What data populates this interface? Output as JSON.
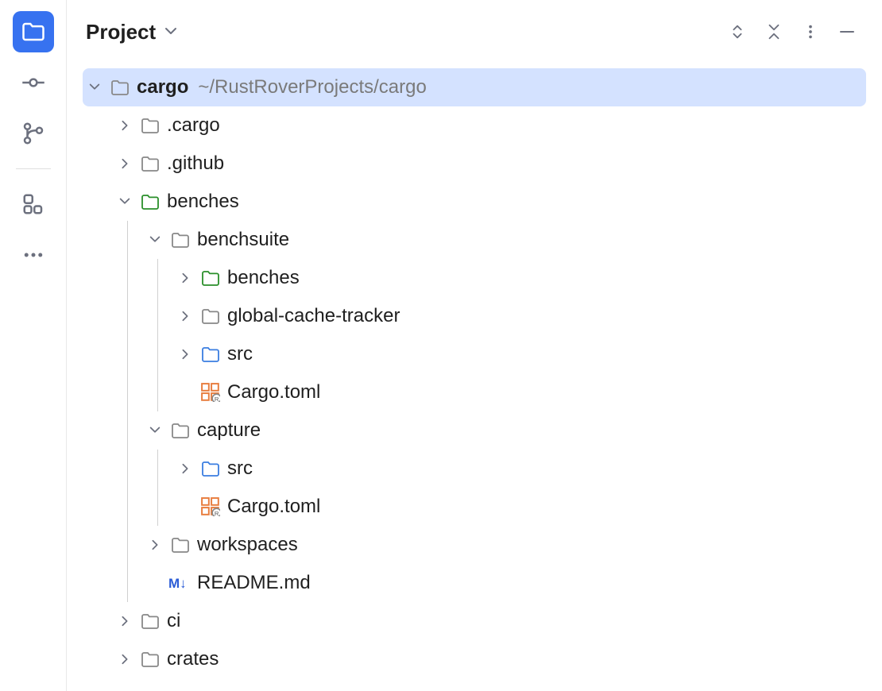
{
  "panel": {
    "title": "Project"
  },
  "tree": {
    "root": {
      "name": "cargo",
      "path": "~/RustRoverProjects/cargo"
    },
    "nodes": {
      "cargo_dot": ".cargo",
      "github": ".github",
      "benches": "benches",
      "benchsuite": "benchsuite",
      "benches_inner": "benches",
      "global_cache": "global-cache-tracker",
      "src1": "src",
      "cargo_toml1": "Cargo.toml",
      "capture": "capture",
      "src2": "src",
      "cargo_toml2": "Cargo.toml",
      "workspaces": "workspaces",
      "readme": "README.md",
      "ci": "ci",
      "crates": "crates"
    }
  }
}
